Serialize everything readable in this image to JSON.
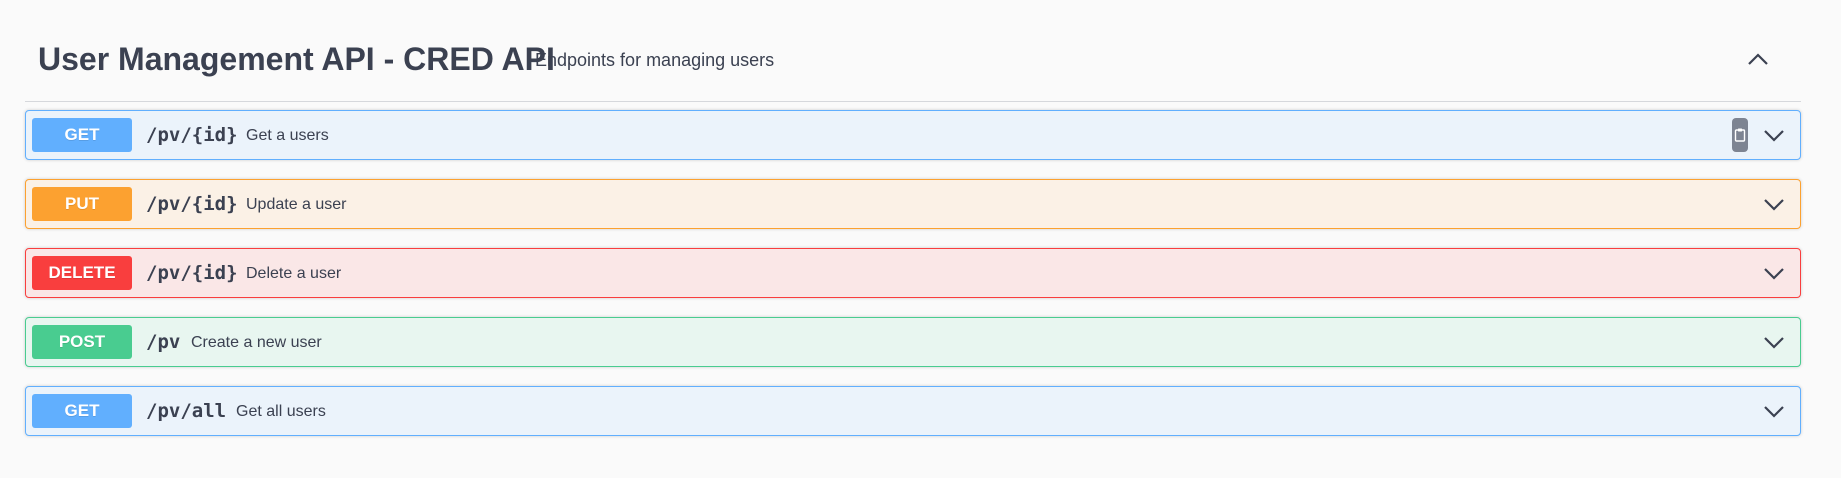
{
  "tag": {
    "title": "User Management API - CRED API",
    "description": "Endpoints for managing users",
    "collapse_icon": "chevron-up-icon"
  },
  "operations": [
    {
      "method": "GET",
      "path": "/pv/{id}",
      "summary": "Get a users",
      "color": "#61affe",
      "has_copy_button": true
    },
    {
      "method": "PUT",
      "path": "/pv/{id}",
      "summary": "Update a user",
      "color": "#fca130"
    },
    {
      "method": "DELETE",
      "path": "/pv/{id}",
      "summary": "Delete a user",
      "color": "#f93e3e"
    },
    {
      "method": "POST",
      "path": "/pv",
      "summary": "Create a new user",
      "color": "#49cc90"
    },
    {
      "method": "GET",
      "path": "/pv/all",
      "summary": "Get all users",
      "color": "#61affe"
    }
  ]
}
